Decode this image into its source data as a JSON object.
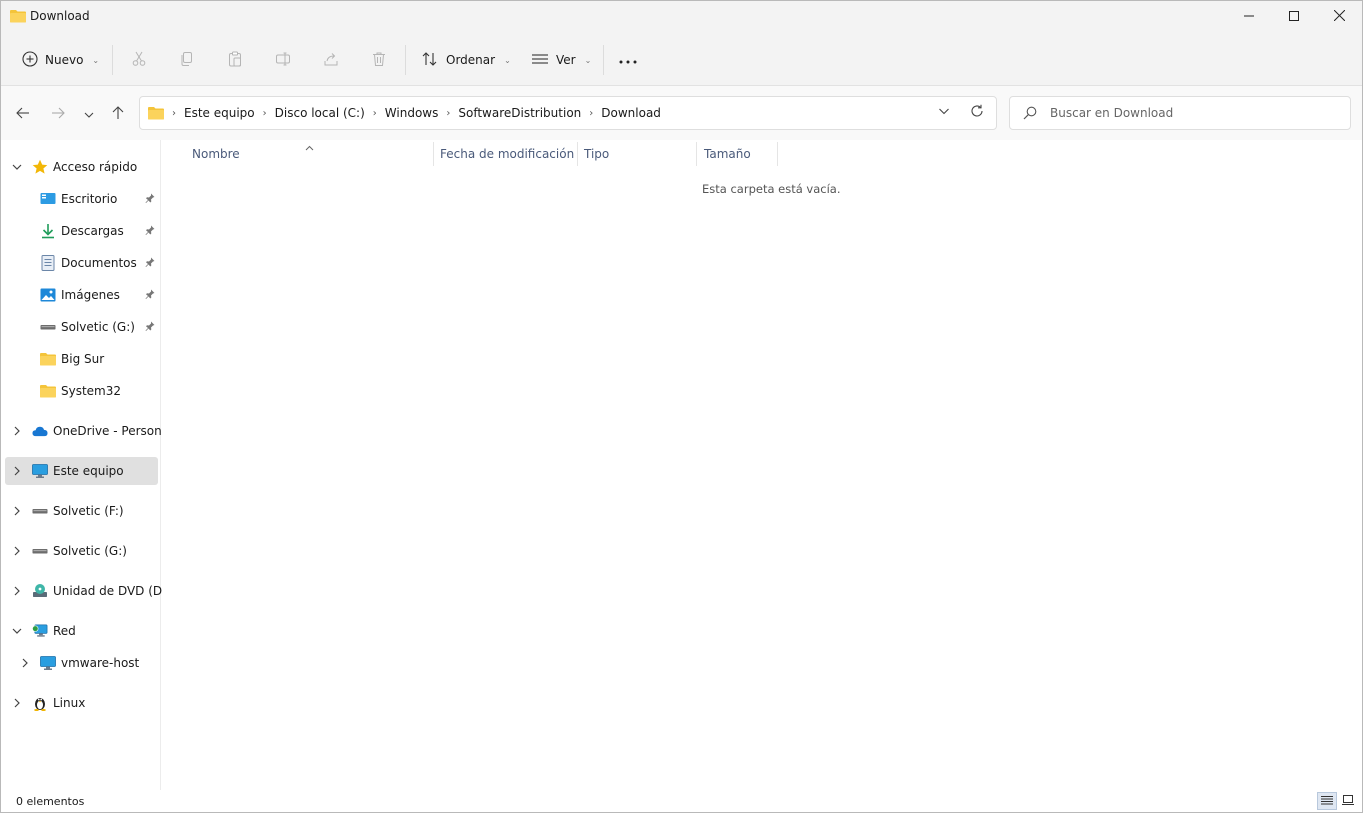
{
  "window": {
    "title": "Download"
  },
  "toolbar": {
    "new_label": "Nuevo",
    "sort_label": "Ordenar",
    "view_label": "Ver"
  },
  "address": {
    "crumbs": [
      "Este equipo",
      "Disco local (C:)",
      "Windows",
      "SoftwareDistribution",
      "Download"
    ]
  },
  "search": {
    "placeholder": "Buscar en Download"
  },
  "sidebar": {
    "quick_access": "Acceso rápido",
    "pinned": [
      "Escritorio",
      "Descargas",
      "Documentos",
      "Imágenes",
      "Solvetic (G:)"
    ],
    "folders": [
      "Big Sur",
      "System32"
    ],
    "onedrive": "OneDrive - Personal",
    "this_pc": "Este equipo",
    "drive_f": "Solvetic (F:)",
    "drive_g": "Solvetic (G:)",
    "dvd": "Unidad de DVD (D:)",
    "network": "Red",
    "vmware": "vmware-host",
    "linux": "Linux"
  },
  "columns": {
    "name": "Nombre",
    "modified": "Fecha de modificación",
    "type": "Tipo",
    "size": "Tamaño"
  },
  "content": {
    "empty_message": "Esta carpeta está vacía."
  },
  "status": {
    "items": "0 elementos"
  },
  "colors": {
    "folder": "#f4c43a",
    "accent": "#0067c0",
    "selected_bg": "#e0e0e0"
  }
}
